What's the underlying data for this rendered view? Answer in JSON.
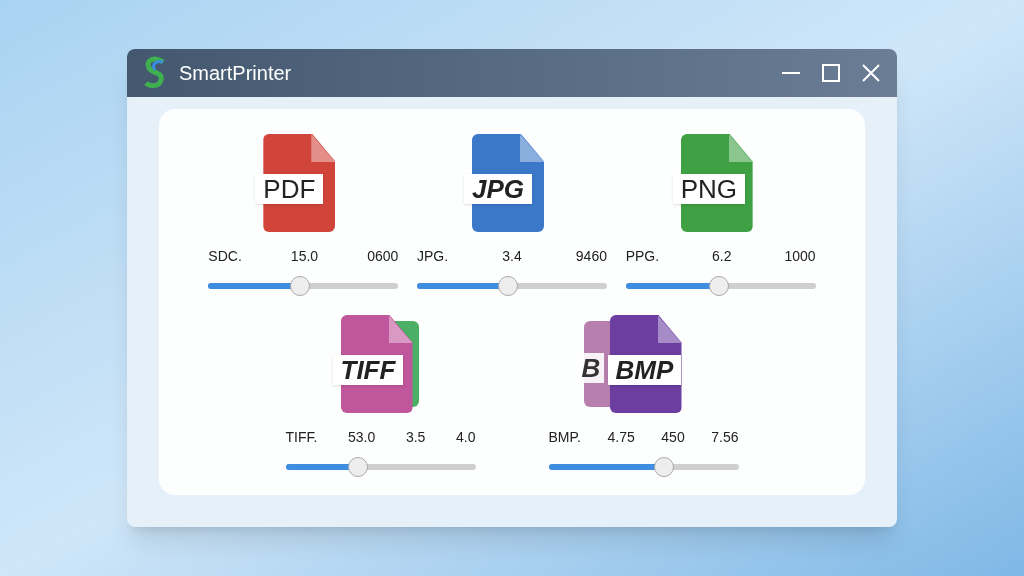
{
  "window": {
    "title": "SmartPrinter"
  },
  "formats": [
    {
      "badge": "PDF",
      "color": "#d0443a",
      "italic": false,
      "name": "SDC.",
      "readings": [
        "15.0",
        "0600"
      ],
      "level": 0.48
    },
    {
      "badge": "JPG",
      "color": "#3b78c8",
      "italic": true,
      "name": "JPG.",
      "readings": [
        "3.4",
        "9460"
      ],
      "level": 0.48
    },
    {
      "badge": "PNG",
      "color": "#3fa044",
      "italic": false,
      "name": "PPG.",
      "readings": [
        "6.2",
        "1000"
      ],
      "level": 0.49
    },
    {
      "badge": "TIFF",
      "color": "#c0569c",
      "italic": true,
      "back": {
        "color": "#4caf66"
      },
      "name": "TIFF.",
      "readings": [
        "53.0",
        "3.5",
        "4.0"
      ],
      "level": 0.38
    },
    {
      "badge": "BMP",
      "color": "#6b3ea0",
      "italic": true,
      "back": {
        "color": "#b77fae",
        "badge": "B"
      },
      "name": "BMP.",
      "readings": [
        "4.75",
        "450",
        "7.56"
      ],
      "level": 0.61
    }
  ]
}
